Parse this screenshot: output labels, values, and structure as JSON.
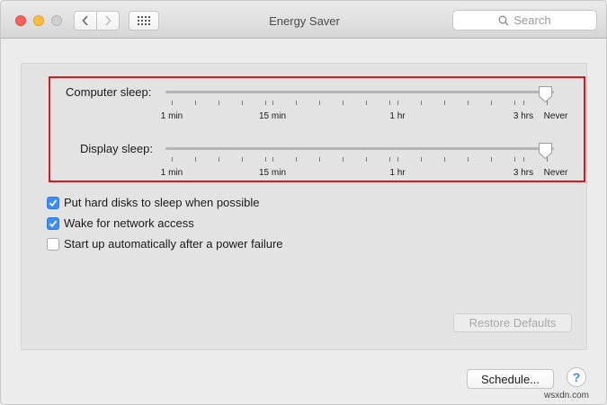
{
  "window": {
    "title": "Energy Saver"
  },
  "search": {
    "placeholder": "Search"
  },
  "sliders": [
    {
      "label": "Computer sleep:",
      "value": "Never",
      "tick_labels": [
        "1 min",
        "15 min",
        "1 hr",
        "3 hrs",
        "Never"
      ]
    },
    {
      "label": "Display sleep:",
      "value": "Never",
      "tick_labels": [
        "1 min",
        "15 min",
        "1 hr",
        "3 hrs",
        "Never"
      ]
    }
  ],
  "options": [
    {
      "label": "Put hard disks to sleep when possible",
      "checked": true
    },
    {
      "label": "Wake for network access",
      "checked": true
    },
    {
      "label": "Start up automatically after a power failure",
      "checked": false
    }
  ],
  "buttons": {
    "restore_defaults": "Restore Defaults",
    "schedule": "Schedule...",
    "help": "?"
  },
  "watermark": "wsxdn.com",
  "colors": {
    "highlight_box": "#d8191f",
    "checkbox_accent": "#3a8ef6"
  }
}
